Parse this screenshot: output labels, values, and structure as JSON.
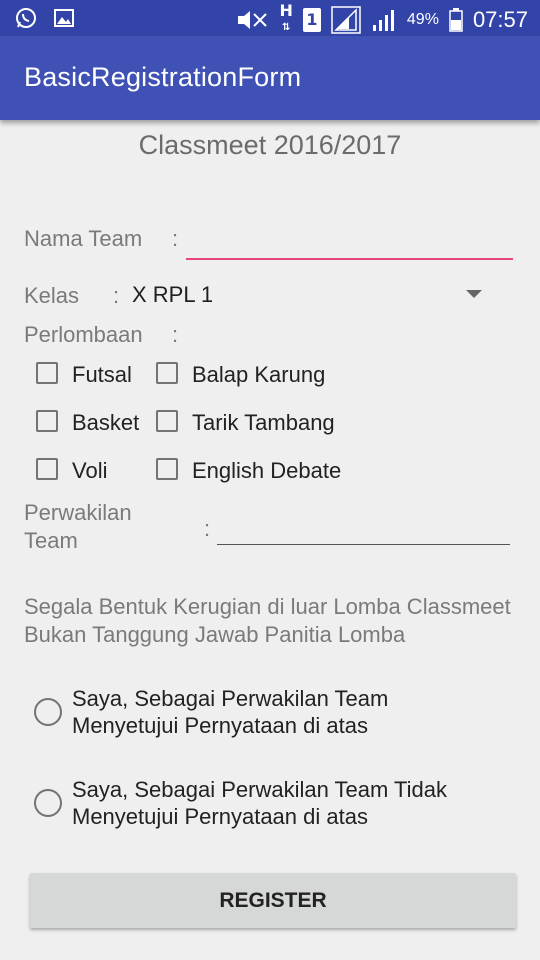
{
  "status_bar": {
    "battery_percent": "49%",
    "time": "07:57",
    "sim_label": "1",
    "network_label": "H",
    "icons": [
      "whatsapp-icon",
      "gallery-icon",
      "mute-icon",
      "network-h-icon",
      "sim-icon",
      "signal-icon",
      "signal-icon",
      "battery-icon"
    ]
  },
  "app_bar": {
    "title": "BasicRegistrationForm"
  },
  "form": {
    "heading": "Classmeet 2016/2017",
    "team_name_label": "Nama Team",
    "team_name_colon": ":",
    "team_name_value": "",
    "class_label": "Kelas",
    "class_colon": ":",
    "class_selected": "X RPL 1",
    "competition_label": "Perlombaan",
    "competition_colon": ":",
    "competitions": [
      "Futsal",
      "Balap Karung",
      "Basket",
      "Tarik Tambang",
      "Voli",
      "English Debate"
    ],
    "rep_label_line1": "Perwakilan",
    "rep_label_line2": "Team",
    "rep_colon": ":",
    "rep_value": "",
    "disclaimer_line1": "Segala Bentuk Kerugian di luar Lomba Classmeet",
    "disclaimer_line2": "Bukan Tanggung Jawab Panitia Lomba",
    "agree_line1": "Saya, Sebagai Perwakilan Team",
    "agree_line2": "Menyetujui Pernyataan di atas",
    "disagree_line1": "Saya, Sebagai Perwakilan Team Tidak",
    "disagree_line2": "Menyetujui Pernyataan di atas",
    "register_button": "REGISTER"
  },
  "colors": {
    "status_bar": "#3344a8",
    "app_bar": "#3f51b5",
    "accent_underline": "#e8457b",
    "background": "#efefef"
  }
}
